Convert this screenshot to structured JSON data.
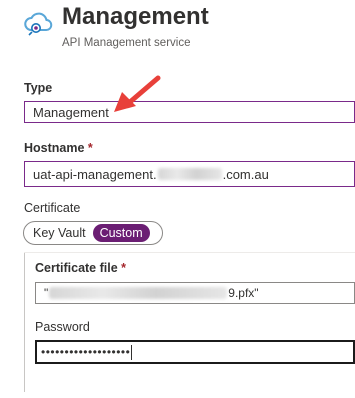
{
  "header": {
    "title": "Management",
    "subtitle": "API Management service",
    "logo_icon": "api-management-cloud-icon"
  },
  "type_field": {
    "label": "Type",
    "value": "Management"
  },
  "hostname_field": {
    "label": "Hostname",
    "required_mark": "*",
    "value_prefix": "uat-api-management.",
    "value_suffix": ".com.au"
  },
  "certificate": {
    "label": "Certificate",
    "options": [
      "Key Vault",
      "Custom"
    ],
    "selected": "Custom"
  },
  "certificate_file": {
    "label": "Certificate file",
    "required_mark": "*",
    "value_prefix": "\"",
    "value_suffix": "9.pfx\""
  },
  "password": {
    "label": "Password",
    "value": "•••••••••••••••••••"
  },
  "annotation": {
    "arrow_icon": "red-arrow-icon",
    "color": "#e8403a"
  },
  "colors": {
    "accent": "#6b1e73",
    "field_border": "#7a2a8a",
    "required": "#a4262c"
  }
}
